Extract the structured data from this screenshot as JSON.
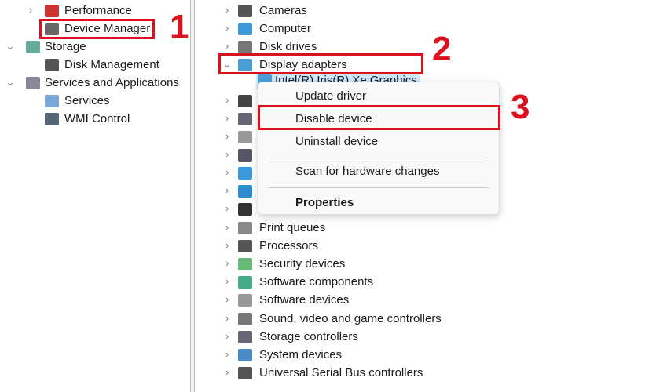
{
  "left_tree": [
    {
      "label": "Performance",
      "icon": "performance-icon",
      "expander": "collapsed"
    },
    {
      "label": "Device Manager",
      "icon": "device-manager-icon",
      "expander": "none"
    },
    {
      "label": "Storage",
      "icon": "storage-icon",
      "expander": "expanded"
    },
    {
      "label": "Disk Management",
      "icon": "disk-management-icon",
      "expander": "none"
    },
    {
      "label": "Services and Applications",
      "icon": "services-apps-icon",
      "expander": "expanded"
    },
    {
      "label": "Services",
      "icon": "gear-icon",
      "expander": "none"
    },
    {
      "label": "WMI Control",
      "icon": "wmi-icon",
      "expander": "none"
    }
  ],
  "device_tree": [
    {
      "label": "Cameras",
      "icon": "camera-icon"
    },
    {
      "label": "Computer",
      "icon": "computer-icon"
    },
    {
      "label": "Disk drives",
      "icon": "disk-drive-icon"
    },
    {
      "label": "Display adapters",
      "icon": "display-adapter-icon",
      "expanded": true
    },
    {
      "label": "Intel(R) Iris(R) Xe Graphics",
      "icon": "display-adapter-icon",
      "child": true
    },
    {
      "label": "",
      "icon": "firmware-icon"
    },
    {
      "label": "",
      "icon": "hid-icon"
    },
    {
      "label": "",
      "icon": "keyboard-icon"
    },
    {
      "label": "",
      "icon": "mouse-icon"
    },
    {
      "label": "",
      "icon": "monitor-icon"
    },
    {
      "label": "",
      "icon": "network-icon"
    },
    {
      "label": "",
      "icon": "unknown-device-icon"
    },
    {
      "label": "Print queues",
      "icon": "printer-icon"
    },
    {
      "label": "Processors",
      "icon": "processor-icon"
    },
    {
      "label": "Security devices",
      "icon": "security-icon"
    },
    {
      "label": "Software components",
      "icon": "software-component-icon"
    },
    {
      "label": "Software devices",
      "icon": "software-device-icon"
    },
    {
      "label": "Sound, video and game controllers",
      "icon": "speaker-icon"
    },
    {
      "label": "Storage controllers",
      "icon": "storage-controller-icon"
    },
    {
      "label": "System devices",
      "icon": "system-device-icon"
    },
    {
      "label": "Universal Serial Bus controllers",
      "icon": "usb-icon"
    }
  ],
  "context_menu": {
    "update": "Update driver",
    "disable": "Disable device",
    "uninstall": "Uninstall device",
    "scan": "Scan for hardware changes",
    "properties": "Properties"
  },
  "annotations": {
    "step1": "1",
    "step2": "2",
    "step3": "3"
  },
  "colors": {
    "highlight": "#d9121e",
    "selection": "#cce8ff"
  }
}
